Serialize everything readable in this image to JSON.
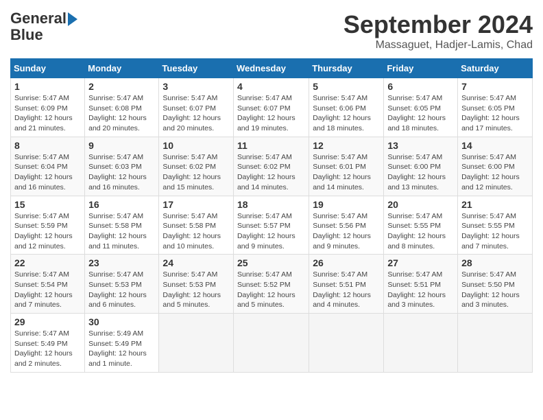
{
  "header": {
    "logo_line1": "General",
    "logo_line2": "Blue",
    "title": "September 2024",
    "subtitle": "Massaguet, Hadjer-Lamis, Chad"
  },
  "calendar": {
    "days_of_week": [
      "Sunday",
      "Monday",
      "Tuesday",
      "Wednesday",
      "Thursday",
      "Friday",
      "Saturday"
    ],
    "weeks": [
      [
        {
          "day": "1",
          "sunrise": "5:47 AM",
          "sunset": "6:09 PM",
          "daylight": "12 hours and 21 minutes."
        },
        {
          "day": "2",
          "sunrise": "5:47 AM",
          "sunset": "6:08 PM",
          "daylight": "12 hours and 20 minutes."
        },
        {
          "day": "3",
          "sunrise": "5:47 AM",
          "sunset": "6:07 PM",
          "daylight": "12 hours and 20 minutes."
        },
        {
          "day": "4",
          "sunrise": "5:47 AM",
          "sunset": "6:07 PM",
          "daylight": "12 hours and 19 minutes."
        },
        {
          "day": "5",
          "sunrise": "5:47 AM",
          "sunset": "6:06 PM",
          "daylight": "12 hours and 18 minutes."
        },
        {
          "day": "6",
          "sunrise": "5:47 AM",
          "sunset": "6:05 PM",
          "daylight": "12 hours and 18 minutes."
        },
        {
          "day": "7",
          "sunrise": "5:47 AM",
          "sunset": "6:05 PM",
          "daylight": "12 hours and 17 minutes."
        }
      ],
      [
        {
          "day": "8",
          "sunrise": "5:47 AM",
          "sunset": "6:04 PM",
          "daylight": "12 hours and 16 minutes."
        },
        {
          "day": "9",
          "sunrise": "5:47 AM",
          "sunset": "6:03 PM",
          "daylight": "12 hours and 16 minutes."
        },
        {
          "day": "10",
          "sunrise": "5:47 AM",
          "sunset": "6:02 PM",
          "daylight": "12 hours and 15 minutes."
        },
        {
          "day": "11",
          "sunrise": "5:47 AM",
          "sunset": "6:02 PM",
          "daylight": "12 hours and 14 minutes."
        },
        {
          "day": "12",
          "sunrise": "5:47 AM",
          "sunset": "6:01 PM",
          "daylight": "12 hours and 14 minutes."
        },
        {
          "day": "13",
          "sunrise": "5:47 AM",
          "sunset": "6:00 PM",
          "daylight": "12 hours and 13 minutes."
        },
        {
          "day": "14",
          "sunrise": "5:47 AM",
          "sunset": "6:00 PM",
          "daylight": "12 hours and 12 minutes."
        }
      ],
      [
        {
          "day": "15",
          "sunrise": "5:47 AM",
          "sunset": "5:59 PM",
          "daylight": "12 hours and 12 minutes."
        },
        {
          "day": "16",
          "sunrise": "5:47 AM",
          "sunset": "5:58 PM",
          "daylight": "12 hours and 11 minutes."
        },
        {
          "day": "17",
          "sunrise": "5:47 AM",
          "sunset": "5:58 PM",
          "daylight": "12 hours and 10 minutes."
        },
        {
          "day": "18",
          "sunrise": "5:47 AM",
          "sunset": "5:57 PM",
          "daylight": "12 hours and 9 minutes."
        },
        {
          "day": "19",
          "sunrise": "5:47 AM",
          "sunset": "5:56 PM",
          "daylight": "12 hours and 9 minutes."
        },
        {
          "day": "20",
          "sunrise": "5:47 AM",
          "sunset": "5:55 PM",
          "daylight": "12 hours and 8 minutes."
        },
        {
          "day": "21",
          "sunrise": "5:47 AM",
          "sunset": "5:55 PM",
          "daylight": "12 hours and 7 minutes."
        }
      ],
      [
        {
          "day": "22",
          "sunrise": "5:47 AM",
          "sunset": "5:54 PM",
          "daylight": "12 hours and 7 minutes."
        },
        {
          "day": "23",
          "sunrise": "5:47 AM",
          "sunset": "5:53 PM",
          "daylight": "12 hours and 6 minutes."
        },
        {
          "day": "24",
          "sunrise": "5:47 AM",
          "sunset": "5:53 PM",
          "daylight": "12 hours and 5 minutes."
        },
        {
          "day": "25",
          "sunrise": "5:47 AM",
          "sunset": "5:52 PM",
          "daylight": "12 hours and 5 minutes."
        },
        {
          "day": "26",
          "sunrise": "5:47 AM",
          "sunset": "5:51 PM",
          "daylight": "12 hours and 4 minutes."
        },
        {
          "day": "27",
          "sunrise": "5:47 AM",
          "sunset": "5:51 PM",
          "daylight": "12 hours and 3 minutes."
        },
        {
          "day": "28",
          "sunrise": "5:47 AM",
          "sunset": "5:50 PM",
          "daylight": "12 hours and 3 minutes."
        }
      ],
      [
        {
          "day": "29",
          "sunrise": "5:47 AM",
          "sunset": "5:49 PM",
          "daylight": "12 hours and 2 minutes."
        },
        {
          "day": "30",
          "sunrise": "5:49 AM",
          "sunset": "5:49 PM",
          "daylight": "12 hours and 1 minute."
        },
        null,
        null,
        null,
        null,
        null
      ]
    ]
  }
}
